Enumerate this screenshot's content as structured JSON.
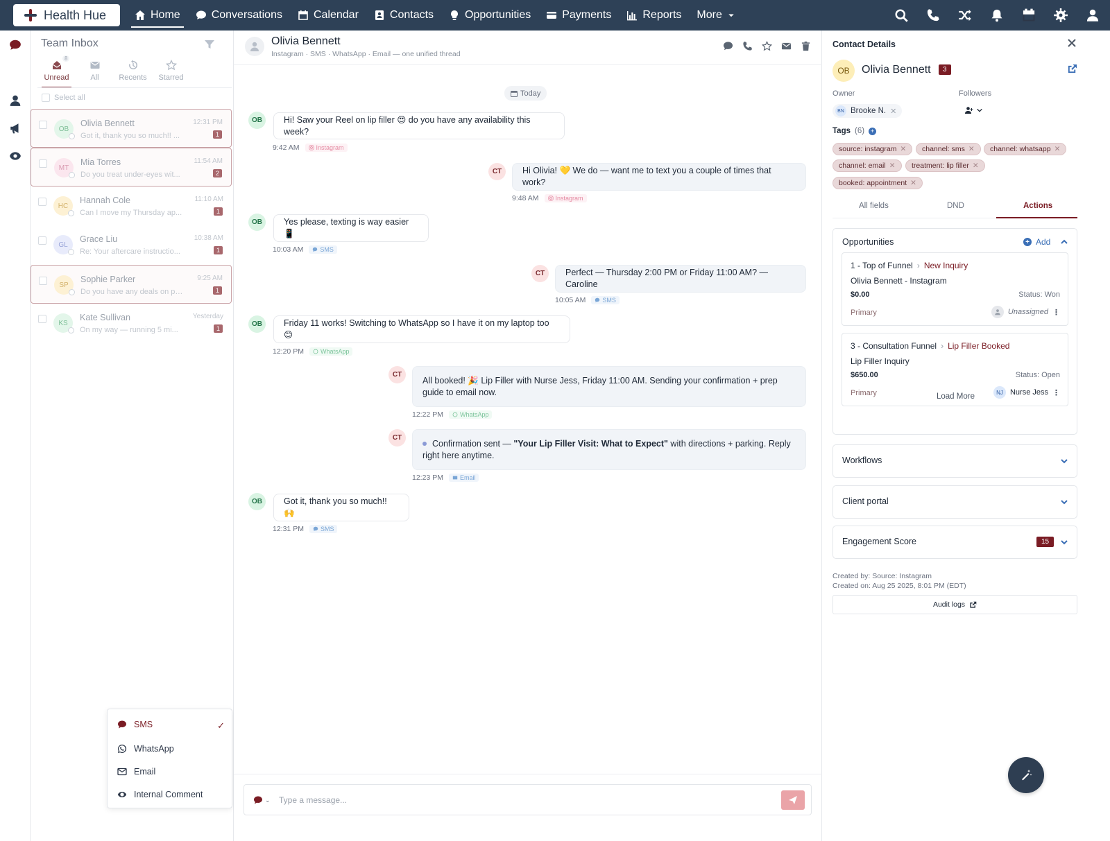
{
  "app": {
    "logo_text": "Health Hue"
  },
  "nav": {
    "items": [
      {
        "label": "Home",
        "icon": "home-icon",
        "active": true
      },
      {
        "label": "Conversations",
        "icon": "chat-icon"
      },
      {
        "label": "Calendar",
        "icon": "calendar-icon"
      },
      {
        "label": "Contacts",
        "icon": "contacts-icon"
      },
      {
        "label": "Opportunities",
        "icon": "lightbulb-icon"
      },
      {
        "label": "Payments",
        "icon": "card-icon"
      },
      {
        "label": "Reports",
        "icon": "chart-icon"
      },
      {
        "label": "More",
        "icon": "caret-down-icon"
      }
    ],
    "right_icons": [
      "search-icon",
      "phone-icon",
      "shuffle-icon",
      "bell-icon",
      "calendar-icon",
      "gear-icon",
      "user-icon"
    ]
  },
  "rail": {
    "icons": [
      "chat-icon",
      "search-icon",
      "user-icon",
      "megaphone-icon",
      "eye-icon"
    ]
  },
  "inbox": {
    "title": "Team Inbox",
    "tabs": [
      {
        "label": "Unread",
        "count": "8",
        "active": true
      },
      {
        "label": "All"
      },
      {
        "label": "Recents"
      },
      {
        "label": "Starred"
      }
    ],
    "select_all": "Select all",
    "conversations": [
      {
        "initials": "OB",
        "name": "Olivia Bennett",
        "preview": "Got it, thank you so much!! ...",
        "time": "12:31 PM",
        "badge": "1",
        "selected": true,
        "av_bg": "#e3f6ea",
        "av_fg": "#7fbf98"
      },
      {
        "initials": "MT",
        "name": "Mia Torres",
        "preview": "Do you treat under-eyes wit...",
        "time": "11:54 AM",
        "badge": "2",
        "selected": true,
        "av_bg": "#fbe6ee",
        "av_fg": "#d99ab1"
      },
      {
        "initials": "HC",
        "name": "Hannah Cole",
        "preview": "Can I move my Thursday ap...",
        "time": "11:10 AM",
        "badge": "1",
        "selected": false,
        "av_bg": "#fdf1d4",
        "av_fg": "#d3b26b"
      },
      {
        "initials": "GL",
        "name": "Grace Liu",
        "preview": "Re: Your aftercare instructio...",
        "time": "10:38 AM",
        "badge": "1",
        "selected": false,
        "av_bg": "#e8ebfb",
        "av_fg": "#9aa5d9"
      },
      {
        "initials": "SP",
        "name": "Sophie Parker",
        "preview": "Do you have any deals on pa...",
        "time": "9:25 AM",
        "badge": "1",
        "selected": true,
        "av_bg": "#fdf1d4",
        "av_fg": "#d3b26b"
      },
      {
        "initials": "KS",
        "name": "Kate Sullivan",
        "preview": "On my way — running 5 mi...",
        "time": "Yesterday",
        "badge": "1",
        "selected": false,
        "av_bg": "#e3f6ea",
        "av_fg": "#7fbf98"
      }
    ]
  },
  "channel_menu": {
    "options": [
      {
        "label": "SMS",
        "icon": "sms-icon",
        "selected": true
      },
      {
        "label": "WhatsApp",
        "icon": "whatsapp-icon"
      },
      {
        "label": "Email",
        "icon": "email-icon"
      },
      {
        "label": "Internal Comment",
        "icon": "eye-icon"
      }
    ],
    "check": "✓"
  },
  "thread": {
    "name": "Olivia Bennett",
    "subtitle": "Instagram · SMS · WhatsApp · Email — one unified thread",
    "actions": [
      "chat-icon",
      "phone-icon",
      "star-icon",
      "email-icon",
      "trash-icon"
    ],
    "date_label": "Today",
    "messages": [
      {
        "dir": "in",
        "avatar": "OB",
        "text": "Hi! Saw your Reel on lip filler 😍 do you have any availability this week?",
        "time": "9:42 AM",
        "channel": "Instagram",
        "ch": "ig"
      },
      {
        "dir": "out",
        "avatar": "CT",
        "text": "Hi Olivia! 💛 We do — want me to text you a couple of times that work?",
        "time": "9:48 AM",
        "channel": "Instagram",
        "ch": "ig"
      },
      {
        "dir": "in",
        "avatar": "OB",
        "text": "Yes please, texting is way easier 📱",
        "time": "10:03 AM",
        "channel": "SMS",
        "ch": "sms"
      },
      {
        "dir": "out",
        "avatar": "CT",
        "text": "Perfect — Thursday 2:00 PM or Friday 11:00 AM? — Caroline",
        "time": "10:05 AM",
        "channel": "SMS",
        "ch": "sms"
      },
      {
        "dir": "in",
        "avatar": "OB",
        "text": "Friday 11 works! Switching to WhatsApp so I have it on my laptop too 😊",
        "time": "12:20 PM",
        "channel": "WhatsApp",
        "ch": "wa"
      },
      {
        "dir": "out",
        "avatar": "CT",
        "text": "All booked! 🎉 Lip Filler with Nurse Jess, Friday 11:00 AM. Sending your confirmation + prep guide to email now.",
        "time": "12:22 PM",
        "channel": "WhatsApp",
        "ch": "wa"
      },
      {
        "dir": "out",
        "avatar": "CT",
        "text_pre": "Confirmation sent — ",
        "text_bold": "\"Your Lip Filler Visit: What to Expect\"",
        "text_post": " with directions + parking. Reply right here anytime.",
        "time": "12:23 PM",
        "channel": "Email",
        "ch": "em"
      },
      {
        "dir": "in",
        "avatar": "OB",
        "text": "Got it, thank you so much!! 🙌",
        "time": "12:31 PM",
        "channel": "SMS",
        "ch": "sms"
      }
    ],
    "composer": {
      "placeholder": "Type a message..."
    }
  },
  "contact": {
    "panel_title": "Contact Details",
    "initials": "OB",
    "name": "Olivia Bennett",
    "badge": "3",
    "owner_label": "Owner",
    "owner_initials": "BN",
    "owner_name": "Brooke N.",
    "followers_label": "Followers",
    "tags_label": "Tags",
    "tags_count": "(6)",
    "tags": [
      "source: instagram",
      "channel: sms",
      "channel: whatsapp",
      "channel: email",
      "treatment: lip filler",
      "booked: appointment"
    ],
    "tabs": [
      {
        "label": "All fields"
      },
      {
        "label": "DND"
      },
      {
        "label": "Actions",
        "active": true
      }
    ],
    "opportunities": {
      "title": "Opportunities",
      "add_label": "Add",
      "items": [
        {
          "pipeline": "1 - Top of Funnel",
          "stage": "New Inquiry",
          "name": "Olivia Bennett - Instagram",
          "value": "$0.00",
          "status": "Status: Won",
          "primary": "Primary",
          "assignee_initials": "",
          "assignee": "Unassigned"
        },
        {
          "pipeline": "3 - Consultation Funnel",
          "stage": "Lip Filler Booked",
          "name": "Lip Filler Inquiry",
          "value": "$650.00",
          "status": "Status: Open",
          "primary": "Primary",
          "assignee_initials": "NJ",
          "assignee": "Nurse Jess"
        }
      ],
      "load_more": "Load More"
    },
    "sections": [
      {
        "title": "Workflows"
      },
      {
        "title": "Client portal"
      },
      {
        "title": "Engagement Score",
        "badge": "15"
      }
    ],
    "created_by": "Created by: Source: Instagram",
    "created_on": "Created on: Aug 25 2025, 8:01 PM (EDT)",
    "audit_logs": "Audit logs"
  }
}
